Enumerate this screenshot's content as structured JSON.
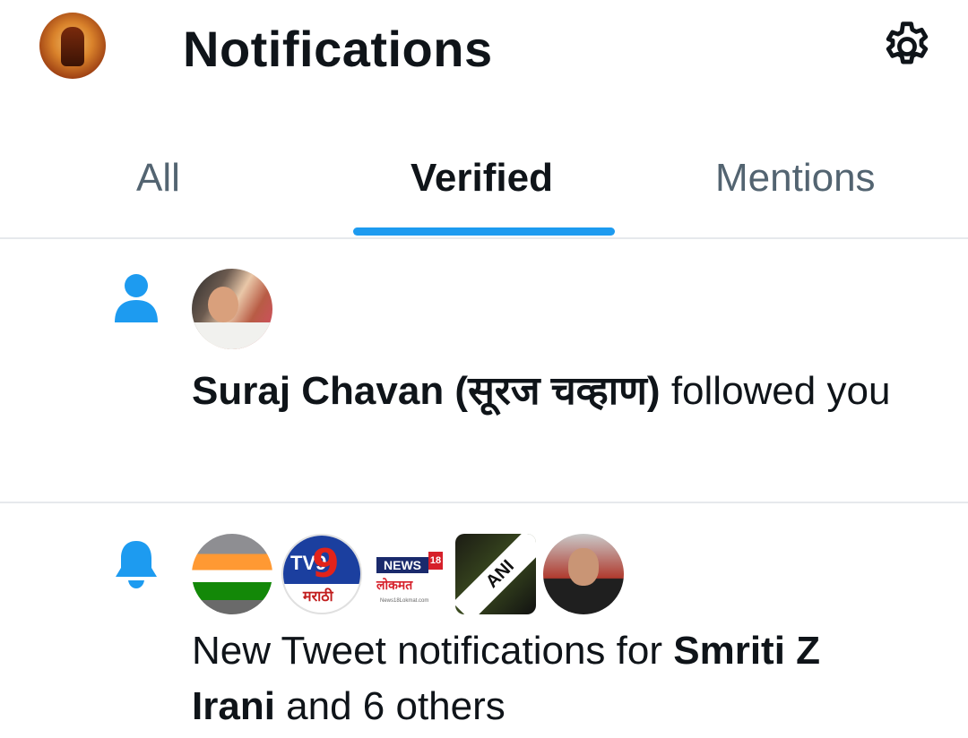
{
  "header": {
    "title": "Notifications",
    "profile_icon": "profile-avatar",
    "settings_icon": "gear-icon"
  },
  "tabs": [
    {
      "label": "All",
      "active": false
    },
    {
      "label": "Verified",
      "active": true
    },
    {
      "label": "Mentions",
      "active": false
    }
  ],
  "accent_color": "#1d9bf0",
  "notifications": [
    {
      "icon": "person-icon",
      "name": "Suraj Chavan (सूरज चव्हाण)",
      "action": " followed you"
    },
    {
      "icon": "bell-icon",
      "prefix": "New Tweet notifications for ",
      "name": "Smriti Z Irani",
      "suffix": " and 6 others",
      "logos": {
        "tv9_brand": "TV9",
        "tv9_sub": "मराठी",
        "news18_brand": "NEWS",
        "news18_num": "18",
        "news18_sub": "लोकमत",
        "news18_site": "News18Lokmat.com",
        "ani_brand": "ANI"
      }
    }
  ]
}
